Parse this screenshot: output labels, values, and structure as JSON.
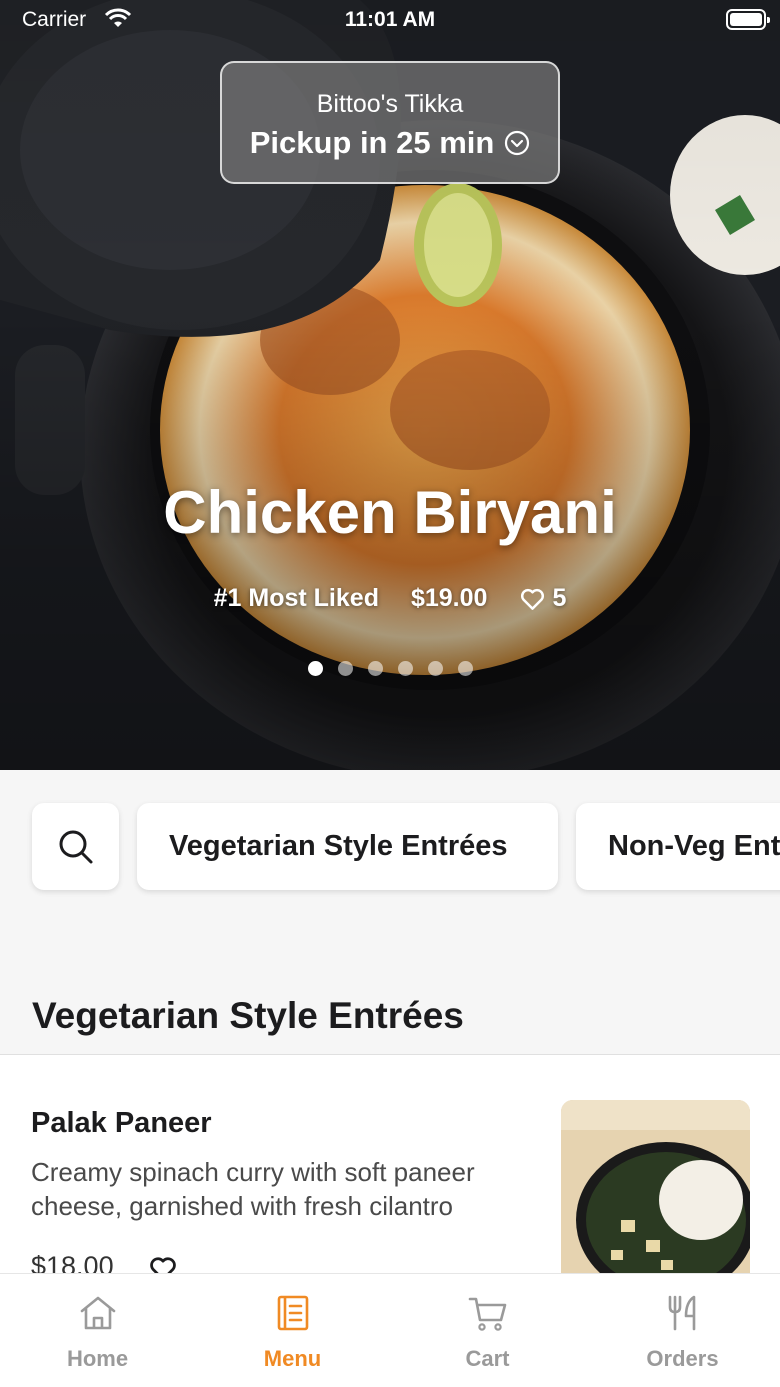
{
  "status_bar": {
    "carrier": "Carrier",
    "time": "11:01 AM"
  },
  "pickup": {
    "restaurant": "Bittoo's Tikka",
    "pickup_time": "Pickup in 25 min"
  },
  "featured": {
    "title": "Chicken Biryani",
    "badge": "#1 Most Liked",
    "price": "$19.00",
    "likes": "5",
    "slide_count": 6,
    "active_slide": 0
  },
  "categories": {
    "search_icon": "search-icon",
    "items": [
      "Vegetarian Style Entrées",
      "Non-Veg  Entrées"
    ]
  },
  "section": {
    "title": "Vegetarian Style Entrées"
  },
  "menu_items": [
    {
      "name": "Palak Paneer",
      "description": "Creamy spinach curry with soft paneer cheese, garnished with fresh cilantro",
      "price": "$18.00"
    }
  ],
  "tabs": [
    {
      "label": "Home",
      "icon": "home-icon",
      "active": false
    },
    {
      "label": "Menu",
      "icon": "menu-book-icon",
      "active": true
    },
    {
      "label": "Cart",
      "icon": "cart-icon",
      "active": false
    },
    {
      "label": "Orders",
      "icon": "fork-knife-icon",
      "active": false
    }
  ],
  "colors": {
    "accent": "#f08a24",
    "tab_inactive": "#9a9a9a",
    "background": "#f6f6f6"
  }
}
